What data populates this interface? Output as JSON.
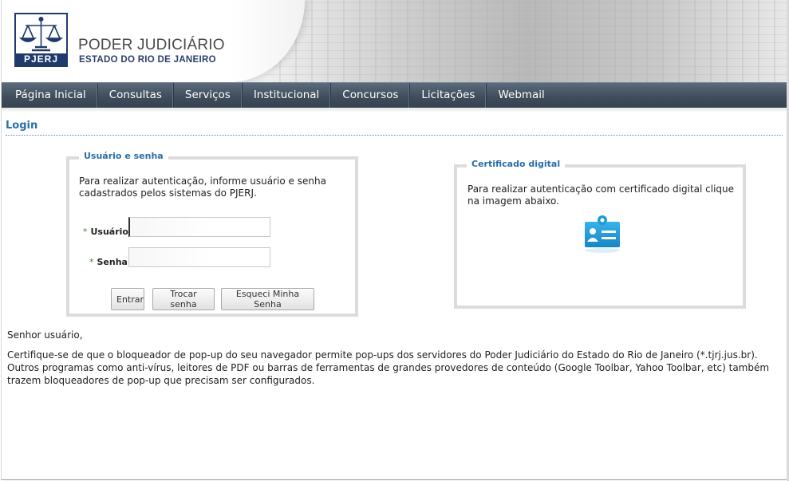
{
  "header": {
    "logo_text": "PJERJ",
    "org_title": "PODER JUDICIÁRIO",
    "org_subtitle": "ESTADO DO RIO DE JANEIRO"
  },
  "nav": {
    "items": [
      {
        "label": "Página Inicial"
      },
      {
        "label": "Consultas"
      },
      {
        "label": "Serviços"
      },
      {
        "label": "Institucional"
      },
      {
        "label": "Concursos"
      },
      {
        "label": "Licitações"
      },
      {
        "label": "Webmail"
      }
    ]
  },
  "page_title": "Login",
  "user_login": {
    "legend": "Usuário e senha",
    "intro": "Para realizar autenticação, informe usuário e senha cadastrados pelos sistemas do PJERJ.",
    "required_marker": "*",
    "username_label": "Usuário:",
    "username_value": "",
    "password_label": "Senha:",
    "password_value": "",
    "buttons": {
      "submit": "Entrar",
      "change_password": "Trocar senha",
      "forgot_password": "Esqueci Minha Senha"
    }
  },
  "certificate": {
    "legend": "Certificado digital",
    "intro": "Para realizar autenticação com certificado digital clique na imagem abaixo.",
    "icon": "id-card-icon",
    "icon_color": "#1f9ad6"
  },
  "notice": {
    "greeting": "Senhor usuário,",
    "message": "Certifique-se de que o bloqueador de pop-up do seu navegador permite pop-ups dos servidores do Poder Judiciário do Estado do Rio de Janeiro (*.tjrj.jus.br). Outros programas como anti-vírus, leitores de PDF ou barras de ferramentas de grandes provedores de conteúdo (Google Toolbar, Yahoo Toolbar, etc) também trazem bloqueadores de pop-up que precisam ser configurados."
  },
  "colors": {
    "nav_bg": "#3f4d5c",
    "accent_blue": "#2a6ea8",
    "brand_navy": "#1f3a6b"
  }
}
